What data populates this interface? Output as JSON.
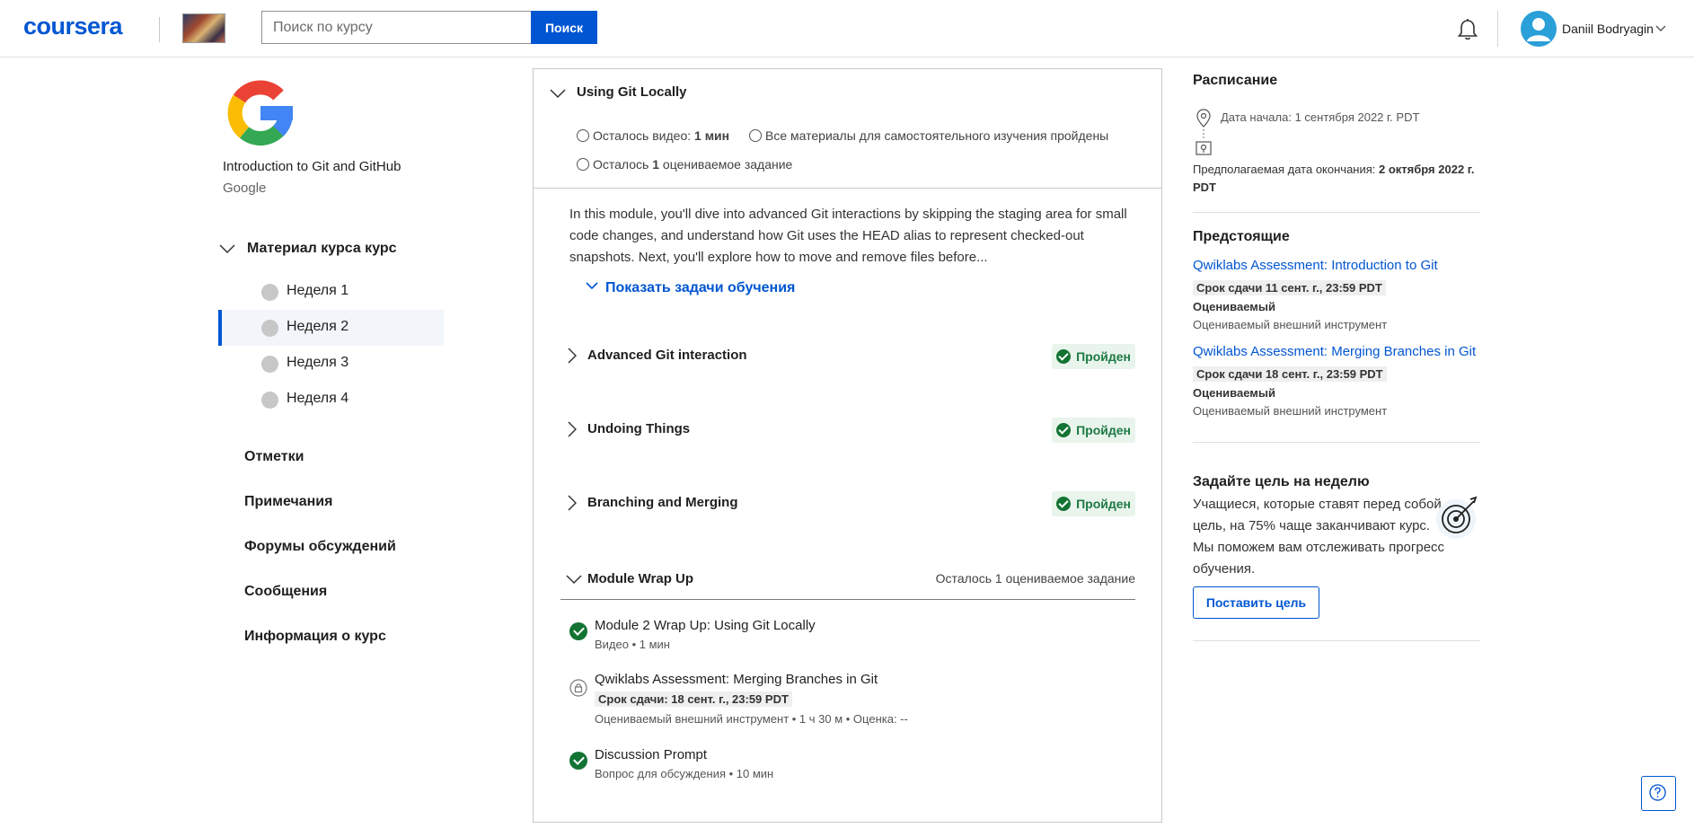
{
  "header": {
    "logo_text": "coursera",
    "search_placeholder": "Поиск по курсу",
    "search_button": "Поиск",
    "user_name": "Daniil Bodryagin"
  },
  "sidebar": {
    "course_title": "Introduction to Git and GitHub",
    "course_org": "Google",
    "material_label": "Материал курса курс",
    "weeks": [
      {
        "label": "Неделя 1",
        "active": false
      },
      {
        "label": "Неделя 2",
        "active": true
      },
      {
        "label": "Неделя 3",
        "active": false
      },
      {
        "label": "Неделя 4",
        "active": false
      }
    ],
    "links": [
      "Отметки",
      "Примечания",
      "Форумы обсуждений",
      "Сообщения",
      "Информация о курс"
    ]
  },
  "module": {
    "title": "Using Git Locally",
    "meta_video_prefix": "Осталось видео:",
    "meta_video_value": "1 мин",
    "meta_self_study": "Все материалы для самостоятельного изучения пройдены",
    "meta_graded_prefix": "Осталось",
    "meta_graded_count": "1",
    "meta_graded_suffix": "оцениваемое задание",
    "description": "In this module, you'll dive into advanced Git interactions by skipping the staging area for small code changes, and understand how Git uses the HEAD alias to represent checked-out snapshots. Next, you'll explore how to move and remove files before...",
    "show_objectives": "Показать задачи обучения",
    "lessons": [
      {
        "title": "Advanced Git interaction",
        "status": "Пройден"
      },
      {
        "title": "Undoing Things",
        "status": "Пройден"
      },
      {
        "title": "Branching and Merging",
        "status": "Пройден"
      }
    ],
    "wrapup": {
      "title": "Module Wrap Up",
      "remaining": "Осталось 1 оцениваемое задание",
      "items": [
        {
          "title": "Module 2 Wrap Up: Using Git Locally",
          "sub": "Видео • 1 мин"
        },
        {
          "title": "Qwiklabs Assessment: Merging Branches in Git",
          "due": "Срок сдачи: 18 сент. г., 23:59 PDT",
          "sub": "Оцениваемый внешний инструмент • 1 ч 30 м • Оценка: --"
        },
        {
          "title": "Discussion Prompt",
          "sub": "Вопрос для обсуждения • 10 мин"
        }
      ]
    }
  },
  "schedule": {
    "title": "Расписание",
    "start_date": "Дата начала: 1 сентября 2022 г. PDT",
    "end_prefix": "Предполагаемая дата окончания:",
    "end_value": "2 октября 2022 г. PDT"
  },
  "upcoming": {
    "title": "Предстоящие",
    "items": [
      {
        "link": "Qwiklabs Assessment: Introduction to Git",
        "due": "Срок сдачи 11 сент. г., 23:59 PDT",
        "type": "Оцениваемый",
        "desc": "Оцениваемый внешний инструмент"
      },
      {
        "link": "Qwiklabs Assessment: Merging Branches in Git",
        "due": "Срок сдачи 18 сент. г., 23:59 PDT",
        "type": "Оцениваемый",
        "desc": "Оцениваемый внешний инструмент"
      }
    ]
  },
  "goal": {
    "title": "Задайте цель на неделю",
    "text": "Учащиеся, которые ставят перед собой цель, на 75% чаще заканчивают курс. Мы поможем вам отслеживать прогресс обучения.",
    "button": "Поставить цель"
  },
  "colors": {
    "brand": "#0056d2",
    "success": "#137333"
  }
}
